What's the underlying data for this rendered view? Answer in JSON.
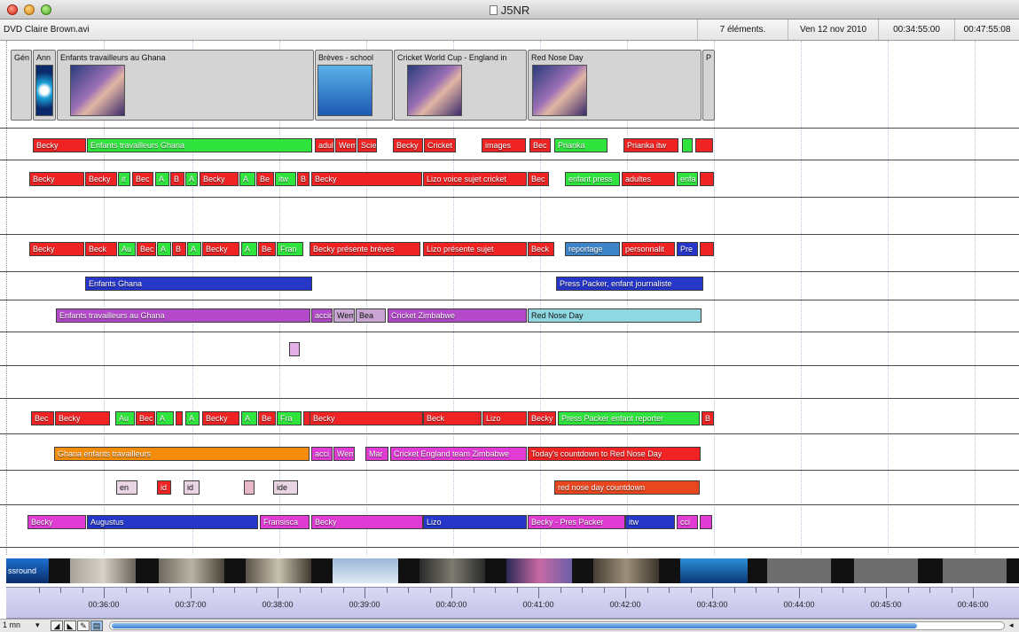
{
  "window": {
    "title": "J5NR"
  },
  "infobar": {
    "filename": "DVD Claire Brown.avi",
    "items": "7 éléments.",
    "date": "Ven 12 nov 2010",
    "duration": "00:34:55:00",
    "end": "00:47:55:08"
  },
  "colors": {
    "red": "#ef2323",
    "green": "#2fe53d",
    "blue": "#2536c9",
    "purple": "#b348c9",
    "cyan": "#8fd8e2",
    "orange": "#f58d0a",
    "pink": "#e37ab9",
    "brown": "#d2691e",
    "magenta": "#e03bd4",
    "rustred": "#e8461e"
  },
  "sequences": [
    {
      "label": "Gén"
    },
    {
      "label": "Ann"
    },
    {
      "label": "Enfants travailleurs au Ghana"
    },
    {
      "label": "Brèves - school"
    },
    {
      "label": "Cricket World Cup - England in"
    },
    {
      "label": "Red Nose Day"
    },
    {
      "label": "P"
    }
  ],
  "track1": [
    "Becky",
    "Enfants travailleurs Ghana",
    "adul",
    "Wem",
    "Scie",
    "Becky",
    "Cricket",
    "images",
    "Bec",
    "Prianka",
    "Prianka itw"
  ],
  "track2": [
    "Becky",
    "Becky",
    "it",
    "Bec",
    "A",
    "B",
    "A",
    "Becky",
    "A",
    "Be",
    "itw",
    "B",
    "Becky",
    "Lizo voice sujet cricket",
    "Bec",
    "enfant press",
    "adultes",
    "enfa"
  ],
  "track4": [
    "Becky",
    "Beck",
    "Au",
    "Bec",
    "A",
    "B",
    "A",
    "Becky",
    "A",
    "Be",
    "Fran",
    "Becky présente brèves",
    "Lizo présente sujet",
    "Beck",
    "reportage",
    "personnalit",
    "Pre"
  ],
  "track5": [
    "Enfants Ghana",
    "Press Packer, enfant journaliste"
  ],
  "track6": [
    "Enfants travailleurs au Ghana",
    "accid",
    "Wem",
    "Bea",
    "Cricket Zimbabwe",
    "Red Nose Day"
  ],
  "track10": [
    "Bec",
    "Becky",
    "Au",
    "Bec",
    "A",
    "A",
    "Becky",
    "A",
    "Be",
    "Fra",
    "Becky",
    "Beck",
    "Lizo",
    "Becky",
    "Press Packer enfant reporter",
    "B"
  ],
  "track11": [
    "Ghana enfants travailleurs",
    "acci",
    "Wem",
    "Mar",
    "Cricket England team Zimbabwe",
    "Today's countdown to Red Nose Day"
  ],
  "track12": [
    "en",
    "id",
    "id",
    "ide",
    "red nose day countdown"
  ],
  "track13": [
    "Becky",
    "Augustus",
    "Fransisca",
    "Becky",
    "Lizo",
    "Becky - Pres Packer",
    "itw",
    "cci"
  ],
  "filmstrip": {
    "logo": "ssround"
  },
  "ruler": {
    "labels": [
      "00:36:00",
      "00:37:00",
      "00:38:00",
      "00:39:00",
      "00:40:00",
      "00:41:00",
      "00:42:00",
      "00:43:00",
      "00:44:00",
      "00:45:00",
      "00:46:00"
    ]
  },
  "bottom": {
    "zoom": "1 mn"
  }
}
